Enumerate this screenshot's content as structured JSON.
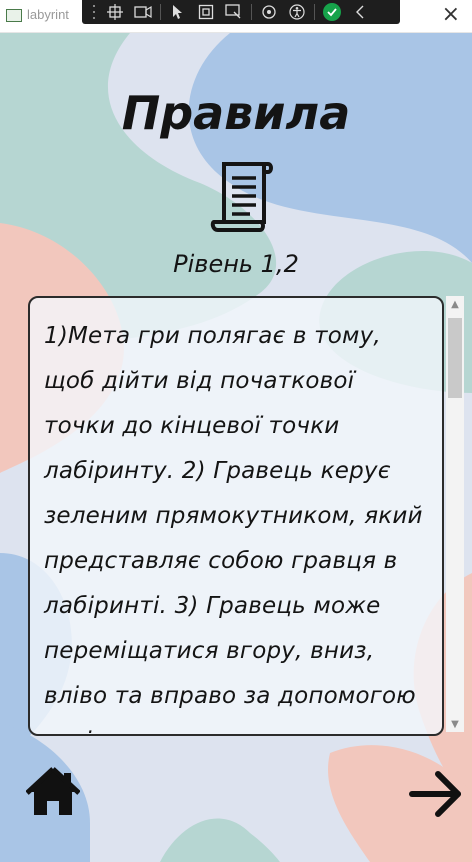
{
  "window": {
    "title": "labyrint"
  },
  "page": {
    "title": "Правила",
    "level_label": "Рівень 1,2"
  },
  "rules": {
    "text": "1)Мета гри полягає в тому, щоб дійти від початкової точки до кінцевої точки лабіринту. 2) Гравець керує зеленим прямокутником, який представляє собою гравця в лабіринті. 3) Гравець може переміщатися вгору, вниз, вліво та вправо за допомогою стрілок на"
  },
  "icons": {
    "app": "app-window-icon",
    "scroll": "scroll-icon",
    "home": "home-icon",
    "next": "arrow-right-icon",
    "close": "close-icon"
  },
  "colors": {
    "blue_wave": "#a9c5e6",
    "teal_wave": "#b6d6d2",
    "pink_wave": "#f2c7bd",
    "lavender": "#dde3ef"
  }
}
